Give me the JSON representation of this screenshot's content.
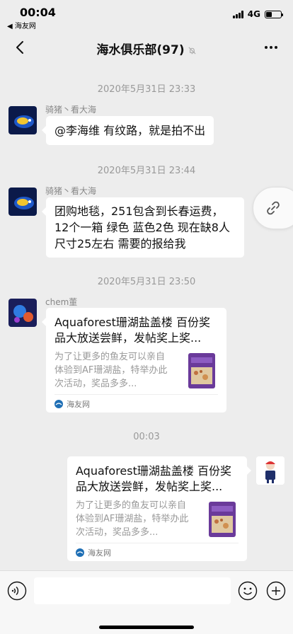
{
  "status": {
    "time": "00:04",
    "back_app": "◀ 海友网",
    "network": "4G"
  },
  "nav": {
    "title": "海水俱乐部(97)"
  },
  "messages": [
    {
      "timestamp": "2020年5月31日 23:33",
      "sender": "骑猪丶看大海",
      "text": "@李海维 有纹路，就是拍不出"
    },
    {
      "timestamp": "2020年5月31日 23:44",
      "sender": "骑猪丶看大海",
      "text": " 团购地毯，251包含到长春运费，12个一箱 绿色 蓝色2色 现在缺8人 尺寸25左右 需要的报给我"
    },
    {
      "timestamp": "2020年5月31日 23:50",
      "sender": "chem董",
      "card": {
        "title": "Aquaforest珊湖盐盖楼 百份奖品大放送尝鲜，发帖奖上奖...",
        "desc": "为了让更多的鱼友可以亲自体验到AF珊湖盐，特举办此次活动，奖品多多...",
        "source": "海友网"
      }
    },
    {
      "timestamp": "00:03",
      "sender": "",
      "card": {
        "title": "Aquaforest珊湖盐盖楼 百份奖品大放送尝鲜，发帖奖上奖...",
        "desc": "为了让更多的鱼友可以亲自体验到AF珊湖盐，特举办此次活动，奖品多多...",
        "source": "海友网"
      }
    }
  ],
  "colors": {
    "background": "#ededed",
    "bubble": "#ffffff",
    "timestamp": "#999999"
  }
}
